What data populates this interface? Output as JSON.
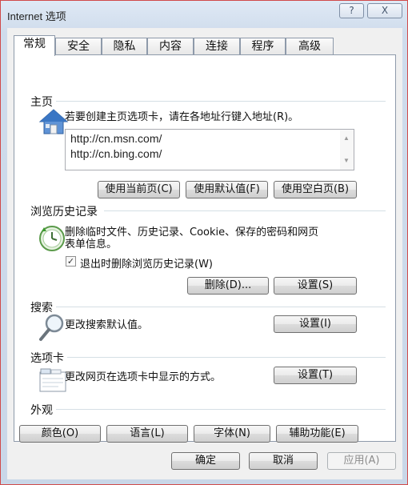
{
  "window": {
    "title": "Internet 选项",
    "help_label": "?",
    "close_label": "X"
  },
  "tabs": [
    {
      "label": "常规"
    },
    {
      "label": "安全"
    },
    {
      "label": "隐私"
    },
    {
      "label": "内容"
    },
    {
      "label": "连接"
    },
    {
      "label": "程序"
    },
    {
      "label": "高级"
    }
  ],
  "home": {
    "group_title": "主页",
    "description": "若要创建主页选项卡，请在各地址行键入地址(R)。",
    "urls": [
      "http://cn.msn.com/",
      "http://cn.bing.com/"
    ],
    "use_current": "使用当前页(C)",
    "use_default": "使用默认值(F)",
    "use_blank": "使用空白页(B)"
  },
  "history": {
    "group_title": "浏览历史记录",
    "description_line1": "删除临时文件、历史记录、Cookie、保存的密码和网页",
    "description_line2": "表单信息。",
    "checkbox_label": "退出时删除浏览历史记录(W)",
    "checkbox_checked": true,
    "delete_button": "删除(D)...",
    "settings_button": "设置(S)"
  },
  "search": {
    "group_title": "搜索",
    "description": "更改搜索默认值。",
    "settings_button": "设置(I)"
  },
  "tabs_group": {
    "group_title": "选项卡",
    "description": "更改网页在选项卡中显示的方式。",
    "settings_button": "设置(T)"
  },
  "appearance": {
    "group_title": "外观",
    "colors_button": "颜色(O)",
    "languages_button": "语言(L)",
    "fonts_button": "字体(N)",
    "accessibility_button": "辅助功能(E)"
  },
  "footer": {
    "ok_button": "确定",
    "cancel_button": "取消",
    "apply_button": "应用(A)"
  },
  "colors": {
    "frame_accent": "#d04a4a",
    "panel_border": "#8e9aaa",
    "window_bg": "#c9d7e8"
  },
  "icons": {
    "home": "home-icon",
    "history": "history-clock-icon",
    "search": "magnifier-icon",
    "tabs": "tabs-icon"
  }
}
